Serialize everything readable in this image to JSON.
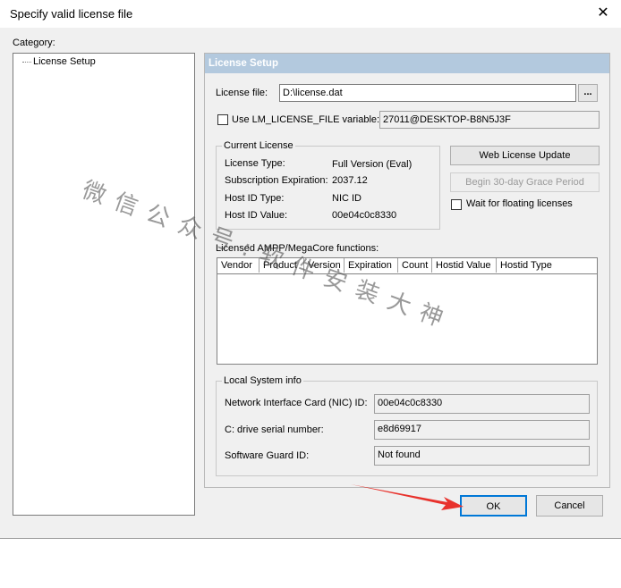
{
  "window": {
    "title": "Specify valid license file",
    "close_glyph": "✕"
  },
  "category": {
    "label": "Category:",
    "items": [
      "License Setup"
    ]
  },
  "panel": {
    "header": "License Setup",
    "license_file_label": "License file:",
    "license_file_value": "D:\\license.dat",
    "browse_label": "...",
    "use_env_label": "Use LM_LICENSE_FILE variable:",
    "env_value": "27011@DESKTOP-B8N5J3F",
    "current_license": {
      "title": "Current License",
      "rows": [
        {
          "label": "License Type:",
          "value": "Full Version (Eval)"
        },
        {
          "label": "Subscription Expiration:",
          "value": "2037.12"
        },
        {
          "label": "Host ID Type:",
          "value": "NIC ID"
        },
        {
          "label": "Host ID Value:",
          "value": "00e04c0c8330"
        }
      ]
    },
    "web_update_label": "Web License Update",
    "grace_period_label": "Begin 30-day Grace Period",
    "wait_floating_label": "Wait for floating licenses",
    "functions_label": "Licensed AMPP/MegaCore functions:",
    "columns": [
      "Vendor",
      "Product",
      "Version",
      "Expiration",
      "Count",
      "Hostid Value",
      "Hostid Type"
    ],
    "local_system": {
      "title": "Local System info",
      "rows": [
        {
          "label": "Network Interface Card (NIC) ID:",
          "value": "00e04c0c8330"
        },
        {
          "label": "C: drive serial number:",
          "value": "e8d69917"
        },
        {
          "label": "Software Guard ID:",
          "value": "Not found"
        }
      ]
    }
  },
  "buttons": {
    "ok": "OK",
    "cancel": "Cancel"
  },
  "watermark": "微信公众号:软件安装大神",
  "colors": {
    "header_bg": "#b3c9de",
    "arrow": "#e8322c"
  },
  "icons": {
    "close": "close-icon",
    "browse": "ellipsis-icon",
    "arrow": "red-arrow-icon"
  }
}
